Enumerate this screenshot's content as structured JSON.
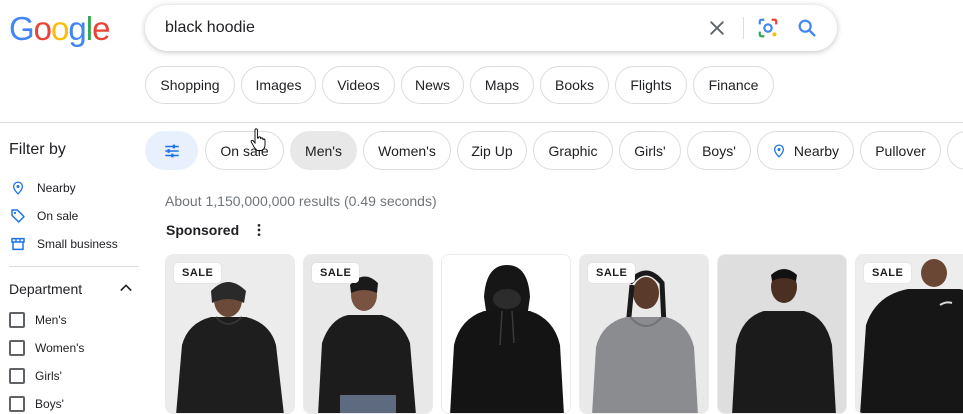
{
  "logo": {
    "letters": [
      "G",
      "o",
      "o",
      "g",
      "l",
      "e"
    ],
    "colors": [
      "#4285f4",
      "#ea4335",
      "#fbbc05",
      "#4285f4",
      "#34a853",
      "#ea4335"
    ]
  },
  "search": {
    "query": "black hoodie"
  },
  "tabs": [
    "Shopping",
    "Images",
    "Videos",
    "News",
    "Maps",
    "Books",
    "Flights",
    "Finance"
  ],
  "chips": [
    {
      "label": "On sale"
    },
    {
      "label": "Men's",
      "selected": true
    },
    {
      "label": "Women's"
    },
    {
      "label": "Zip Up"
    },
    {
      "label": "Graphic"
    },
    {
      "label": "Girls'"
    },
    {
      "label": "Boys'"
    },
    {
      "label": "Nearby"
    },
    {
      "label": "Pullover"
    }
  ],
  "sidebar": {
    "title": "Filter by",
    "items": [
      {
        "label": "Nearby",
        "icon": "location-pin-icon"
      },
      {
        "label": "On sale",
        "icon": "tag-icon"
      },
      {
        "label": "Small business",
        "icon": "storefront-icon"
      }
    ],
    "department": {
      "title": "Department",
      "options": [
        "Men's",
        "Women's",
        "Girls'",
        "Boys'"
      ]
    }
  },
  "results": {
    "stats": "About 1,150,000,000 results (0.49 seconds)",
    "sponsored_label": "Sponsored",
    "products": [
      {
        "badge": "SALE"
      },
      {
        "badge": "SALE"
      },
      {
        "badge": ""
      },
      {
        "badge": "SALE"
      },
      {
        "badge": ""
      },
      {
        "badge": "SALE"
      }
    ]
  },
  "colors": {
    "accent": "#1a73e8",
    "chip_selected": "#e8e8e8",
    "settings_chip": "#e8f0fe"
  }
}
